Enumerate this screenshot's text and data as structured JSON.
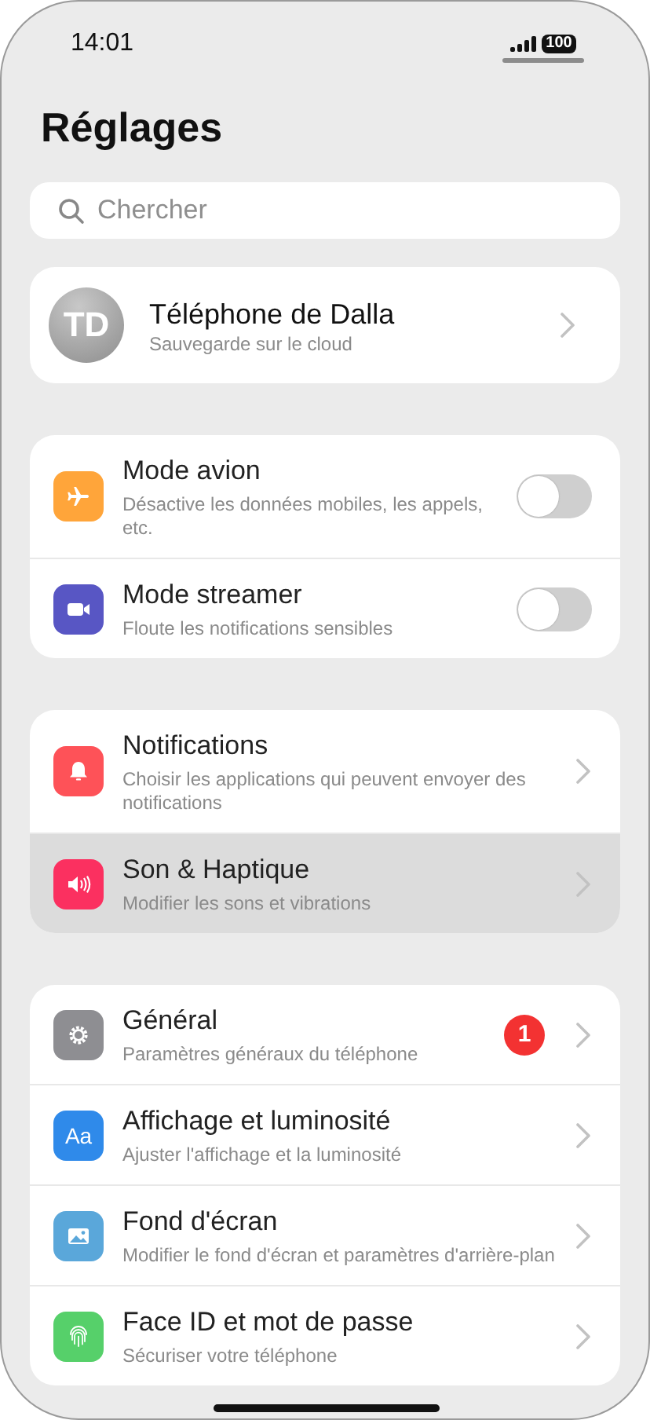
{
  "status_bar": {
    "time": "14:01",
    "battery": "100"
  },
  "title": "Réglages",
  "search": {
    "placeholder": "Chercher"
  },
  "profile": {
    "initials": "TD",
    "name": "Téléphone de Dalla",
    "subtitle": "Sauvegarde sur le cloud"
  },
  "groups": [
    {
      "items": [
        {
          "kind": "toggle",
          "color": "#ffa53a",
          "title": "Mode avion",
          "subtitle": "Désactive les données mobiles, les appels, etc.",
          "on": false,
          "selected": false
        },
        {
          "kind": "toggle",
          "color": "#5856c4",
          "title": "Mode streamer",
          "subtitle": "Floute les notifications sensibles",
          "on": false,
          "selected": false
        }
      ]
    },
    {
      "items": [
        {
          "kind": "link",
          "color": "#fe5258",
          "title": "Notifications",
          "subtitle": "Choisir les applications qui peuvent envoyer des notifications",
          "selected": false
        },
        {
          "kind": "link",
          "color": "#fb3060",
          "title": "Son & Haptique",
          "subtitle": "Modifier les sons et vibrations",
          "selected": true
        }
      ]
    },
    {
      "items": [
        {
          "kind": "link",
          "color": "#8e8e92",
          "title": "Général",
          "subtitle": "Paramètres généraux du téléphone",
          "badge": "1",
          "selected": false
        },
        {
          "kind": "link",
          "icon_text": "Aa",
          "color": "#2f8aea",
          "title": "Affichage et luminosité",
          "subtitle": "Ajuster l'affichage et la luminosité",
          "selected": false
        },
        {
          "kind": "link",
          "color": "#5aa7da",
          "title": "Fond d'écran",
          "subtitle": "Modifier le fond d'écran et paramètres d'arrière-plan",
          "selected": false
        },
        {
          "kind": "link",
          "color": "#56d06a",
          "title": "Face ID et mot de passe",
          "subtitle": "Sécuriser votre téléphone",
          "selected": false
        }
      ]
    }
  ]
}
